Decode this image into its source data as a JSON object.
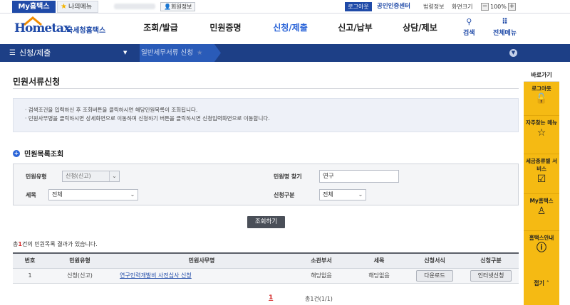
{
  "topbar": {
    "my_tab": "My홈택스",
    "my_menu": "나의메뉴",
    "member_info": "회원정보",
    "logout": "로그아웃",
    "cert_center": "공인인증센터",
    "law_info": "법령정보",
    "zoom_label": "화면크기",
    "zoom_minus": "−",
    "zoom_value": "100%",
    "zoom_plus": "+"
  },
  "header": {
    "logo_mark": "Hometax",
    "logo_text": "국세청홈택스",
    "nav": [
      "조회/발급",
      "민원증명",
      "신청/제출",
      "신고/납부",
      "상담/제보"
    ],
    "active_nav": "신청/제출",
    "search_label": "검색",
    "all_menu_label": "전체메뉴"
  },
  "breadcrumb": {
    "menu": "신청/제출",
    "sub": "일반세무서류 신청"
  },
  "page": {
    "title": "민원서류신청",
    "info": [
      "검색조건을 입력하신 후 조회버튼을 클릭하시면 해당민원목록이 조회됩니다.",
      "민원사무명을 클릭하시면 상세화면으로 이동하며  신청하기 버튼을 클릭하시면 신청입력화면으로 이동합니다."
    ],
    "section_title": "민원목록조회"
  },
  "search": {
    "type_label": "민원유형",
    "type_value": "신청(신고)",
    "tax_label": "세목",
    "tax_value": "전체",
    "name_label": "민원명 찾기",
    "name_value": "연구",
    "kind_label": "신청구분",
    "kind_value": "전체",
    "button": "조회하기"
  },
  "results": {
    "prefix": "총",
    "count": "1",
    "suffix": "건의 민원목록 결과가 있습니다.",
    "columns": [
      "번호",
      "민원유형",
      "민원사무명",
      "소관부서",
      "세목",
      "신청서식",
      "신청구분"
    ],
    "rows": [
      {
        "no": "1",
        "type": "신청(신고)",
        "name": "연구인력개발비 사전심사 신청",
        "dept": "해당없음",
        "tax": "해당없음",
        "form": "다운로드",
        "apply": "인터넷신청"
      }
    ]
  },
  "pager": {
    "current": "1",
    "total": "총1건(1/1)"
  },
  "quick_menu": {
    "head": "바로가기",
    "items": [
      {
        "label": "로그아웃",
        "icon": "unlock-icon"
      },
      {
        "label": "자주찾는 메뉴",
        "icon": "star-icon"
      },
      {
        "label": "세금종류별 서비스",
        "icon": "check-icon"
      },
      {
        "label": "My홈택스",
        "icon": "user-icon"
      },
      {
        "label": "홈택스안내",
        "icon": "info-icon"
      }
    ],
    "close": "접기"
  }
}
